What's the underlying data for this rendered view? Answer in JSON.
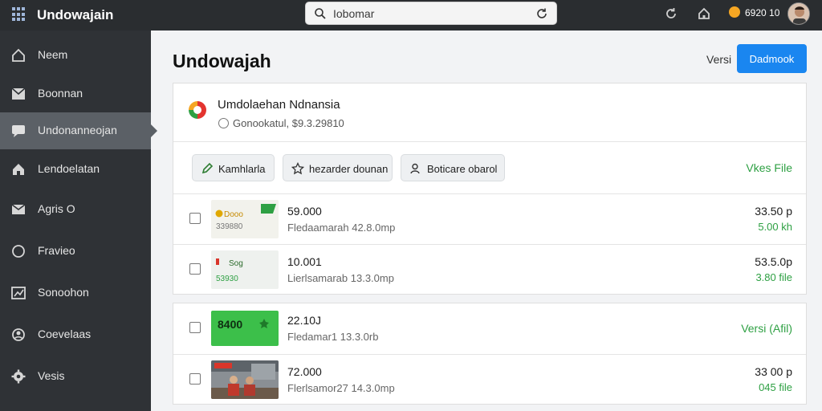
{
  "topbar": {
    "app_title": "Undowajain",
    "search_placeholder": "Iobomar",
    "account_text": "6920 10"
  },
  "sidebar": {
    "items": [
      {
        "label": "Neem",
        "icon": "home-outline-icon"
      },
      {
        "label": "Boonnan",
        "icon": "inbox-icon"
      },
      {
        "label": "Undonanneojan",
        "icon": "chat-icon"
      },
      {
        "label": "Lendoelatan",
        "icon": "home-icon"
      },
      {
        "label": "Agris O",
        "icon": "mail-icon"
      },
      {
        "label": "Fravieo",
        "icon": "circle-icon"
      },
      {
        "label": "Sonoohon",
        "icon": "chart-icon"
      },
      {
        "label": "Coevelaas",
        "icon": "people-icon"
      },
      {
        "label": "Vesis",
        "icon": "gear-icon"
      }
    ],
    "active_index": 2
  },
  "main": {
    "title": "Undowajah",
    "versi_label": "Versi",
    "primary_button": "Dadmook"
  },
  "card": {
    "title": "Umdolaehan Ndnansia",
    "subtitle": "Gonookatul, $9.3.29810",
    "chips": [
      {
        "label": "Kamhlarla",
        "icon": "pencil-icon"
      },
      {
        "label": "hezarder dounan",
        "icon": "star-icon"
      },
      {
        "label": "Boticare obarol",
        "icon": "user-icon"
      }
    ],
    "view_file": "Vkes File"
  },
  "rows": [
    {
      "title": "59.000",
      "subtitle": "Fledaamarah 42.8.0mp",
      "price": "33.50 p",
      "size": "5.00 kh",
      "thumb_text": "Dooo",
      "thumb_sub": "339880"
    },
    {
      "title": "10.001",
      "subtitle": "Lierlsamarab 13.3.0mp",
      "price": "53.5.0p",
      "size": "3.80 file",
      "thumb_text": "Sog",
      "thumb_sub": "53930"
    },
    {
      "title": "22.10J",
      "subtitle": "Fledamar1 13.3.0rb",
      "link": "Versi (Afil)",
      "thumb_text": "8400"
    },
    {
      "title": "72.000",
      "subtitle": "Flerlsamor27 14.3.0mp",
      "price": "33 00 p",
      "size": "045 file"
    }
  ],
  "colors": {
    "topbar": "#2a2d30",
    "sidebar": "#2f3236",
    "sidebar_active": "#5b6066",
    "primary": "#1a86f0",
    "accent_green": "#2ea043"
  }
}
